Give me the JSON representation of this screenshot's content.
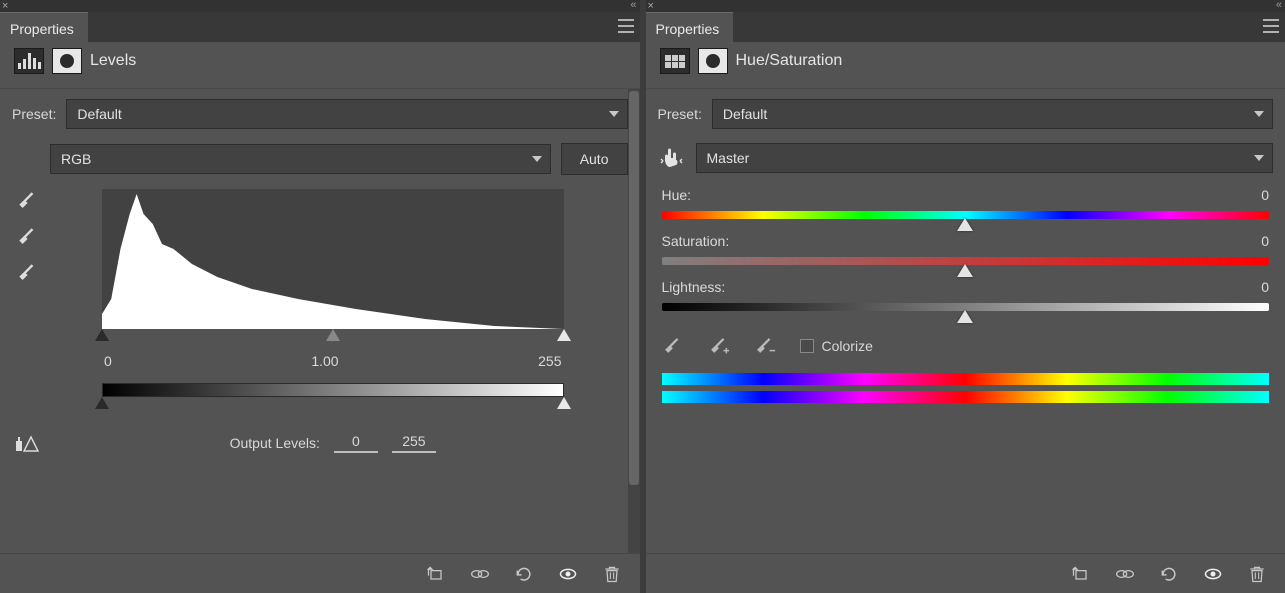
{
  "left": {
    "tab_title": "Properties",
    "adjustment_name": "Levels",
    "preset_label": "Preset:",
    "preset_value": "Default",
    "channel_value": "RGB",
    "auto_label": "Auto",
    "input_black": "0",
    "input_gamma": "1.00",
    "input_white": "255",
    "output_label": "Output Levels:",
    "output_black": "0",
    "output_white": "255"
  },
  "right": {
    "tab_title": "Properties",
    "adjustment_name": "Hue/Saturation",
    "preset_label": "Preset:",
    "preset_value": "Default",
    "edit_value": "Master",
    "hue_label": "Hue:",
    "hue_value": "0",
    "saturation_label": "Saturation:",
    "saturation_value": "0",
    "lightness_label": "Lightness:",
    "lightness_value": "0",
    "colorize_label": "Colorize"
  }
}
